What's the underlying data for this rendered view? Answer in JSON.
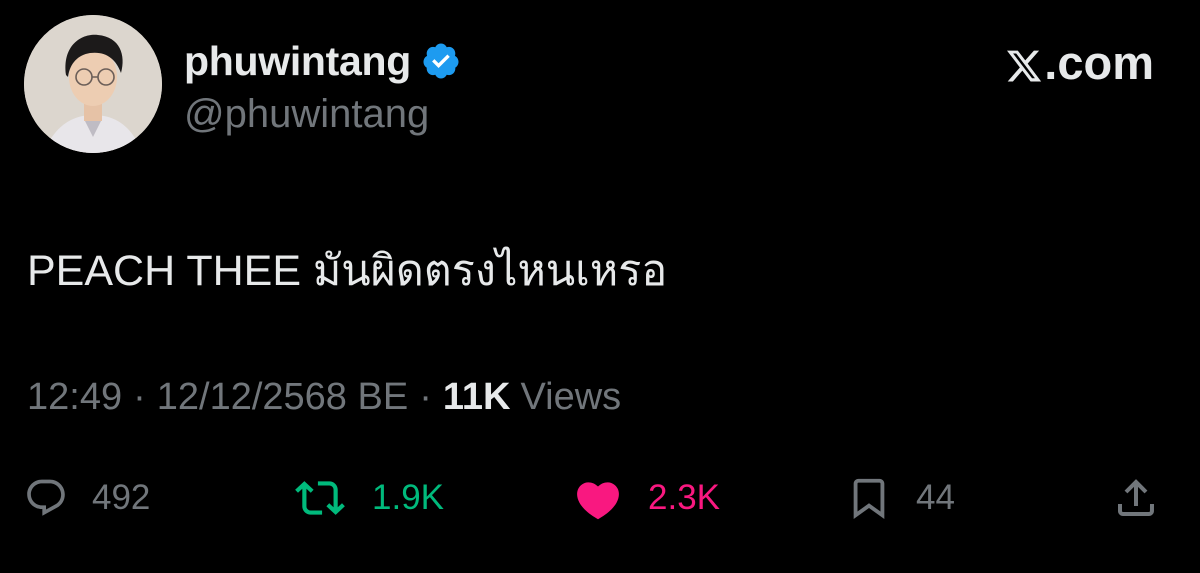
{
  "user": {
    "display_name": "phuwintang",
    "handle": "@phuwintang",
    "verified": true,
    "verified_color": "#1d9bf0",
    "avatar_icon": "profile-photo"
  },
  "brand": {
    "label": ".com",
    "icon": "x-logo-icon"
  },
  "tweet": {
    "text": "PEACH THEE มันผิดตรงไหนเหรอ"
  },
  "meta": {
    "time": "12:49",
    "separator": "·",
    "date": "12/12/2568 BE",
    "views_count": "11K",
    "views_label": "Views"
  },
  "actions": {
    "reply": {
      "count": "492",
      "icon": "reply-icon",
      "color": "#71767b"
    },
    "repost": {
      "count": "1.9K",
      "icon": "repost-icon",
      "color": "#00ba7c"
    },
    "like": {
      "count": "2.3K",
      "icon": "heart-icon",
      "color": "#f91880",
      "active": true
    },
    "bookmark": {
      "count": "44",
      "icon": "bookmark-icon",
      "color": "#71767b"
    },
    "share": {
      "icon": "share-icon",
      "color": "#71767b"
    }
  },
  "colors": {
    "background": "#000000",
    "primary_text": "#e7e9ea",
    "secondary_text": "#71767b"
  }
}
